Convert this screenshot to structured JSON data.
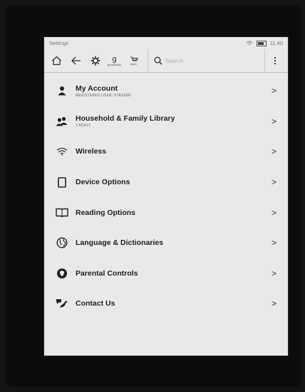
{
  "status": {
    "title": "Settings",
    "time": "11:40"
  },
  "toolbar": {
    "goodreads_glyph": "g",
    "goodreads_label": "goodreads",
    "store_label": "store",
    "search_placeholder": "Search"
  },
  "menu": [
    {
      "label": "My Account",
      "sub": "REGISTERED USER: STASZEK",
      "icon": "person-icon"
    },
    {
      "label": "Household & Family Library",
      "sub": "1 ADULT",
      "icon": "people-icon"
    },
    {
      "label": "Wireless",
      "sub": "",
      "icon": "wifi-icon"
    },
    {
      "label": "Device Options",
      "sub": "",
      "icon": "device-icon"
    },
    {
      "label": "Reading Options",
      "sub": "",
      "icon": "book-icon"
    },
    {
      "label": "Language & Dictionaries",
      "sub": "",
      "icon": "globe-icon"
    },
    {
      "label": "Parental Controls",
      "sub": "",
      "icon": "shield-icon"
    },
    {
      "label": "Contact Us",
      "sub": "",
      "icon": "support-icon"
    }
  ],
  "chevron": ">"
}
